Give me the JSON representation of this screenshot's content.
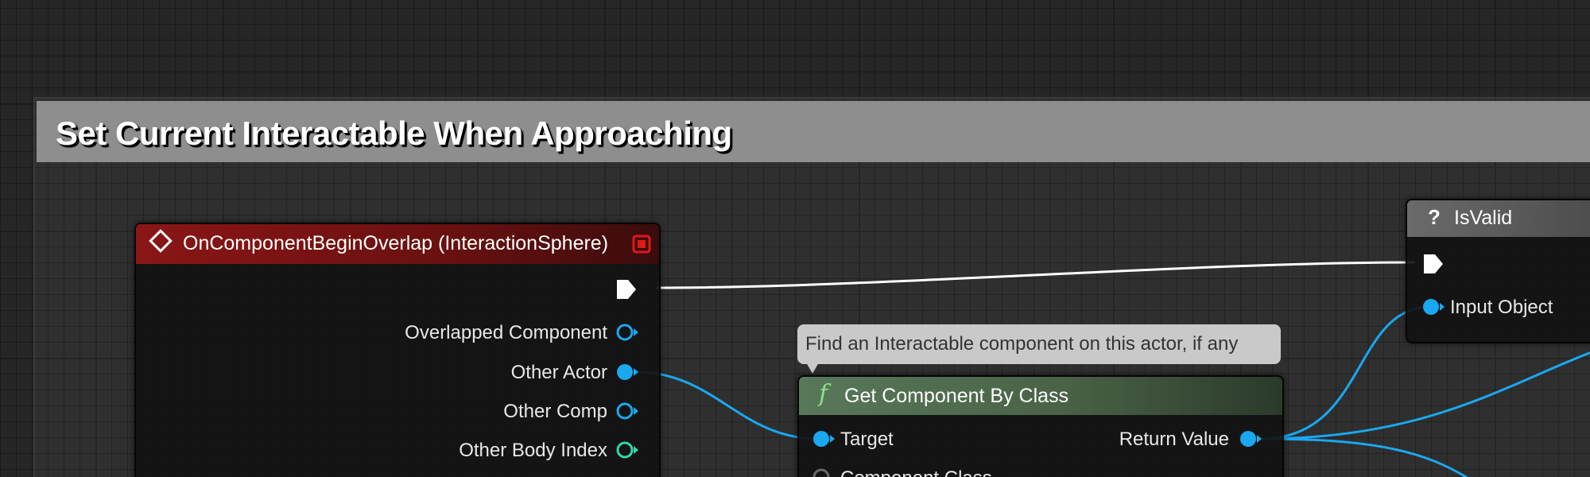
{
  "comment": {
    "title": "Set Current Interactable When Approaching"
  },
  "event_node": {
    "title": "OnComponentBeginOverlap (InteractionSphere)",
    "header_color": "#8a1616",
    "pins": [
      {
        "label": "Overlapped Component",
        "type": "object",
        "color": "#1aa8f0"
      },
      {
        "label": "Other Actor",
        "type": "object",
        "color": "#1aa8f0",
        "connected": true
      },
      {
        "label": "Other Comp",
        "type": "object",
        "color": "#1aa8f0"
      },
      {
        "label": "Other Body Index",
        "type": "integer",
        "color": "#2ed9a8"
      }
    ]
  },
  "tooltip": {
    "text": "Find an Interactable component on this actor, if any"
  },
  "function_node": {
    "title": "Get Component By Class",
    "icon": "f",
    "header_color": "#4f6e4a",
    "input_pins": [
      {
        "label": "Target",
        "type": "object",
        "color": "#1aa8f0"
      },
      {
        "label": "Component Class",
        "type": "class",
        "color": "#6b6b6b"
      }
    ],
    "output_pins": [
      {
        "label": "Return Value",
        "type": "object",
        "color": "#1aa8f0"
      }
    ]
  },
  "isvalid_node": {
    "title": "IsValid",
    "icon": "?",
    "header_color": "#5a5a5a",
    "input_pins": [
      {
        "label": "Input Object",
        "type": "object",
        "color": "#1aa8f0"
      }
    ]
  },
  "colors": {
    "exec_wire": "#ffffff",
    "object_wire": "#1aa8f0",
    "integer_pin": "#2ed9a8",
    "background": "#262626"
  }
}
